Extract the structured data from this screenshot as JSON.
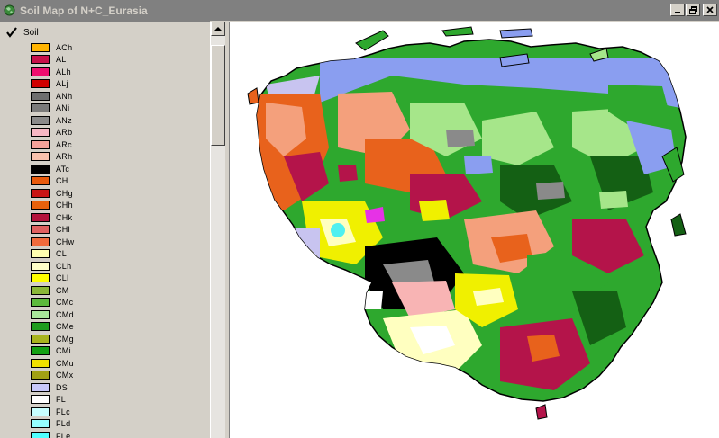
{
  "window": {
    "title": "Soil Map of N+C_Eurasia",
    "buttons": [
      "minimize",
      "maximize",
      "close"
    ]
  },
  "toc": {
    "layer_name": "Soil",
    "layer_visible": true,
    "legend": [
      {
        "code": "ACh",
        "color": "#ffb400"
      },
      {
        "code": "AL",
        "color": "#c8104a"
      },
      {
        "code": "ALh",
        "color": "#ee0e6e"
      },
      {
        "code": "ALj",
        "color": "#d00000"
      },
      {
        "code": "ANh",
        "color": "#6e6e6e"
      },
      {
        "code": "ANi",
        "color": "#7a7a7a"
      },
      {
        "code": "ANz",
        "color": "#8a8a8a"
      },
      {
        "code": "ARb",
        "color": "#f7b7c4"
      },
      {
        "code": "ARc",
        "color": "#f5a29a"
      },
      {
        "code": "ARh",
        "color": "#f8c1ad"
      },
      {
        "code": "ATc",
        "color": "#000000"
      },
      {
        "code": "CH",
        "color": "#e85a0c"
      },
      {
        "code": "CHg",
        "color": "#c81414"
      },
      {
        "code": "CHh",
        "color": "#e8610c"
      },
      {
        "code": "CHk",
        "color": "#b4143c"
      },
      {
        "code": "CHl",
        "color": "#e06060"
      },
      {
        "code": "CHw",
        "color": "#f06a3c"
      },
      {
        "code": "CL",
        "color": "#ffffb0"
      },
      {
        "code": "CLh",
        "color": "#ffffc8"
      },
      {
        "code": "CLl",
        "color": "#ffff00"
      },
      {
        "code": "CM",
        "color": "#8ab838"
      },
      {
        "code": "CMc",
        "color": "#5cba3c"
      },
      {
        "code": "CMd",
        "color": "#a8e69a"
      },
      {
        "code": "CMe",
        "color": "#1e9c1e"
      },
      {
        "code": "CMg",
        "color": "#a8b41e"
      },
      {
        "code": "CMi",
        "color": "#14a014"
      },
      {
        "code": "CMu",
        "color": "#f0e000"
      },
      {
        "code": "CMx",
        "color": "#a0a014"
      },
      {
        "code": "DS",
        "color": "#c8c8fa"
      },
      {
        "code": "FL",
        "color": "#ffffff"
      },
      {
        "code": "FLc",
        "color": "#c8ffff"
      },
      {
        "code": "FLd",
        "color": "#96ffff"
      },
      {
        "code": "FLe",
        "color": "#50ffff"
      }
    ]
  },
  "map": {
    "palette": {
      "tundra_blue": "#8a9ef0",
      "light_green": "#a6e68a",
      "green": "#2ea82e",
      "dark_green": "#146014",
      "salmon": "#f4a07c",
      "orange": "#e8621c",
      "crimson": "#b4144a",
      "yellow": "#f0f000",
      "light_yellow": "#ffffc0",
      "black": "#000000",
      "grey": "#8a8a8a",
      "lavender": "#c8c4f0",
      "pink": "#f8b4b4",
      "cyan": "#50f0f0",
      "magenta": "#e632e6"
    }
  }
}
